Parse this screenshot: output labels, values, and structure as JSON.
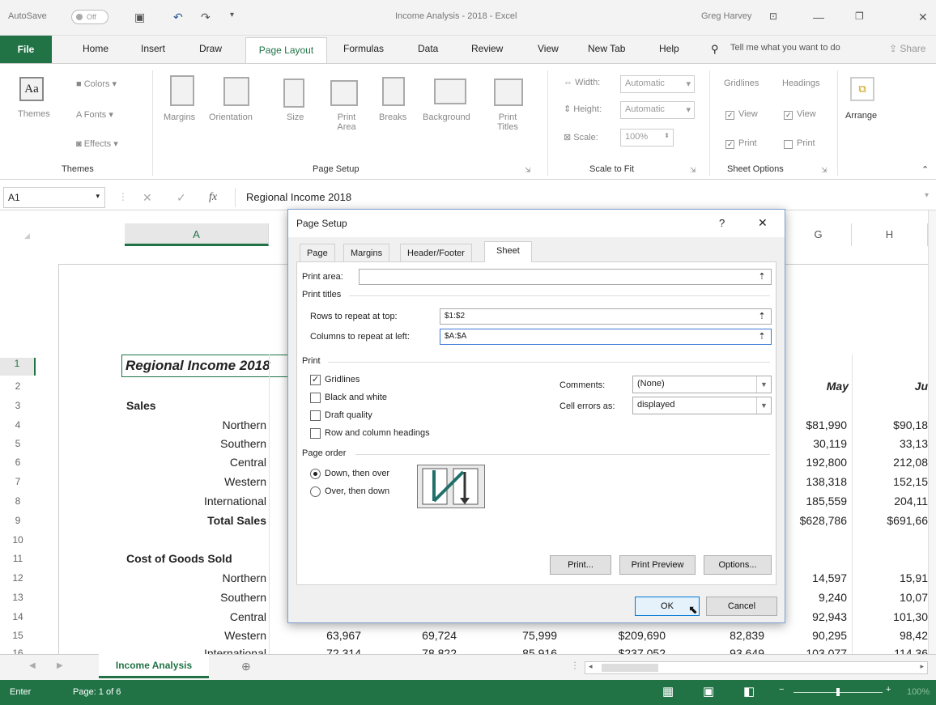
{
  "titlebar": {
    "autosave": "AutoSave",
    "autosave_state": "Off",
    "title": "Income Analysis - 2018  -  Excel",
    "user": "Greg Harvey"
  },
  "tabs": [
    "File",
    "Home",
    "Insert",
    "Draw",
    "Page Layout",
    "Formulas",
    "Data",
    "Review",
    "View",
    "New Tab",
    "Help"
  ],
  "active_tab": "Page Layout",
  "tell_me": "Tell me what you want to do",
  "share": "Share",
  "ribbon": {
    "themes": {
      "label": "Themes",
      "colors": "Colors",
      "fonts": "Fonts",
      "effects": "Effects",
      "group": "Themes"
    },
    "page_setup": {
      "margins": "Margins",
      "orientation": "Orientation",
      "size": "Size",
      "print_area": "Print Area",
      "breaks": "Breaks",
      "background": "Background",
      "print_titles": "Print Titles",
      "group": "Page Setup"
    },
    "scale": {
      "width_label": "Width:",
      "width_val": "Automatic",
      "height_label": "Height:",
      "height_val": "Automatic",
      "scale_label": "Scale:",
      "scale_val": "100%",
      "group": "Scale to Fit"
    },
    "sheet_options": {
      "gridlines": "Gridlines",
      "headings": "Headings",
      "view": "View",
      "print": "Print",
      "group": "Sheet Options"
    },
    "arrange": "Arrange"
  },
  "formula_bar": {
    "name_box": "A1",
    "fx": "fx",
    "content": "Regional Income 2018"
  },
  "columns": {
    "a": "A",
    "g": "G",
    "h": "H"
  },
  "rows": [
    "1",
    "2",
    "3",
    "4",
    "5",
    "6",
    "7",
    "8",
    "9",
    "10",
    "11",
    "12",
    "13",
    "14",
    "15",
    "16"
  ],
  "cells": {
    "a1": "Regional Income 2018",
    "a3": "Sales",
    "a4": "Northern",
    "a5": "Southern",
    "a6": "Central",
    "a7": "Western",
    "a8": "International",
    "a9": "Total Sales",
    "a11": "Cost of Goods Sold",
    "a12": "Northern",
    "a13": "Southern",
    "a14": "Central",
    "a15": "Western",
    "a16": "International",
    "g2": "May",
    "h2": "Ju",
    "g": [
      "$81,990",
      "30,119",
      "192,800",
      "138,318",
      "185,559",
      "$628,786"
    ],
    "h": [
      "$90,18",
      "33,13",
      "212,08",
      "152,15",
      "204,11",
      "$691,66"
    ],
    "g_cogs": [
      "14,597",
      "9,240",
      "92,943",
      "90,295",
      "103,077"
    ],
    "h_cogs": [
      "15,91",
      "10,07",
      "101,30",
      "98,42",
      "114,36"
    ],
    "row15": [
      "63,967",
      "69,724",
      "75,999",
      "$209,690",
      "82,839"
    ],
    "row16": [
      "72,314",
      "78,822",
      "85,916",
      "$237,052",
      "93,649"
    ]
  },
  "sheet_tab": "Income Analysis",
  "status": {
    "mode": "Enter",
    "page": "Page: 1 of 6",
    "zoom": "100%"
  },
  "dialog": {
    "title": "Page Setup",
    "help": "?",
    "close": "✕",
    "tabs": [
      "Page",
      "Margins",
      "Header/Footer",
      "Sheet"
    ],
    "active_tab": "Sheet",
    "print_area_label": "Print area:",
    "print_titles_label": "Print titles",
    "rows_label": "Rows to repeat at top:",
    "rows_value": "$1:$2",
    "cols_label": "Columns to repeat at left:",
    "cols_value": "$A:$A",
    "print_label": "Print",
    "gridlines": "Gridlines",
    "black_white": "Black and white",
    "draft": "Draft quality",
    "row_col_headings": "Row and column headings",
    "comments_label": "Comments:",
    "comments_value": "(None)",
    "errors_label": "Cell errors as:",
    "errors_value": "displayed",
    "page_order_label": "Page order",
    "down_then_over": "Down, then over",
    "over_then_down": "Over, then down",
    "print_btn": "Print...",
    "preview_btn": "Print Preview",
    "options_btn": "Options...",
    "ok_btn": "OK",
    "cancel_btn": "Cancel"
  }
}
